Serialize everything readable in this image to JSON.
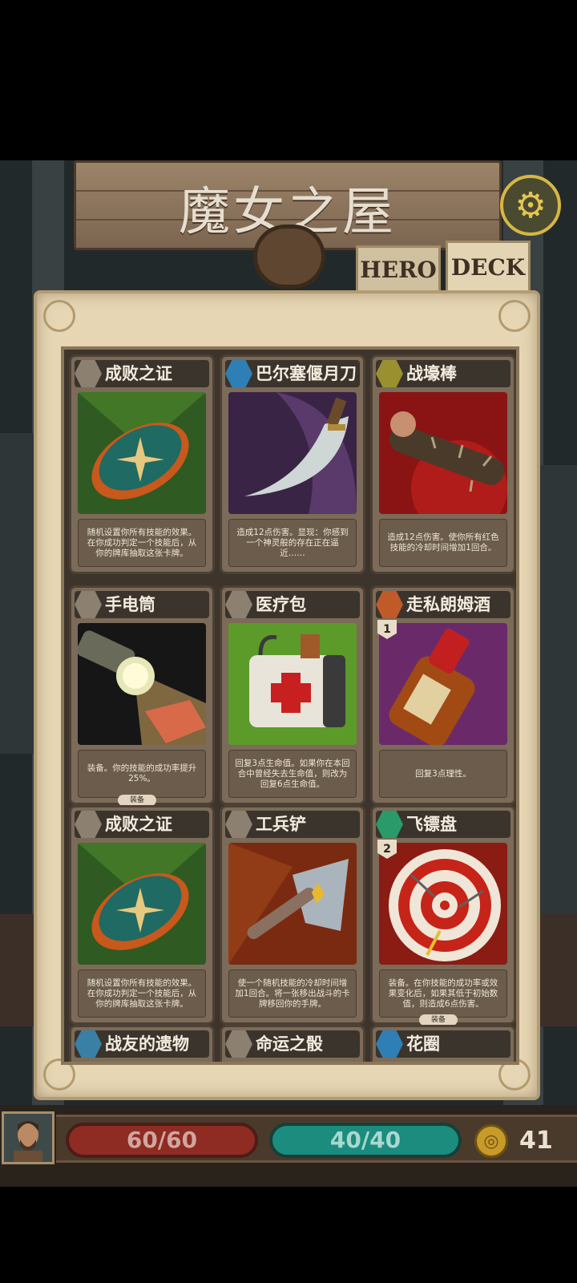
{
  "title": "魔女之屋",
  "tabs": {
    "hero": "HERO",
    "deck": "DECK"
  },
  "settings_icon": "gear-icon",
  "cards": [
    {
      "name": "成败之证",
      "gem": "grey",
      "desc": "随机设置你所有技能的效果。在你成功判定一个技能后，从你的牌库抽取这张卡牌。",
      "badge": "",
      "tag": "",
      "art": "compass"
    },
    {
      "name": "巴尔塞偃月刀",
      "gem": "blue",
      "desc": "造成12点伤害。显现：你感到一个神灵般的存在正在逼近……",
      "badge": "",
      "tag": "",
      "art": "scimitar"
    },
    {
      "name": "战壕棒",
      "gem": "yellow",
      "desc": "造成12点伤害。使你所有红色技能的冷却时间增加1回合。",
      "badge": "",
      "tag": "",
      "art": "club"
    },
    {
      "name": "手电筒",
      "gem": "grey",
      "desc": "装备。你的技能的成功率提升25%。",
      "badge": "",
      "tag": "装备",
      "art": "flashlight"
    },
    {
      "name": "医疗包",
      "gem": "grey",
      "desc": "回复3点生命值。如果你在本回合中曾经失去生命值，则改为回复6点生命值。",
      "badge": "",
      "tag": "",
      "art": "medkit"
    },
    {
      "name": "走私朗姆酒",
      "gem": "orange",
      "desc": "回复3点理性。",
      "badge": "1",
      "tag": "",
      "art": "rum"
    },
    {
      "name": "成败之证",
      "gem": "grey",
      "desc": "随机设置你所有技能的效果。在你成功判定一个技能后，从你的牌库抽取这张卡牌。",
      "badge": "",
      "tag": "",
      "art": "compass"
    },
    {
      "name": "工兵铲",
      "gem": "grey",
      "desc": "使一个随机技能的冷却时间增加1回合。将一张移出战斗的卡牌移回你的手牌。",
      "badge": "",
      "tag": "",
      "art": "shovel"
    },
    {
      "name": "飞镖盘",
      "gem": "green",
      "desc": "装备。在你技能的成功率或效果变化后，如果其低于初始数值，则造成6点伤害。",
      "badge": "2",
      "tag": "装备",
      "art": "dartboard"
    },
    {
      "name": "战友的遗物",
      "gem": "teal",
      "desc": "",
      "badge": "",
      "tag": "",
      "art": ""
    },
    {
      "name": "命运之骰",
      "gem": "grey",
      "desc": "",
      "badge": "",
      "tag": "",
      "art": ""
    },
    {
      "name": "花圈",
      "gem": "blue",
      "desc": "",
      "badge": "",
      "tag": "",
      "art": ""
    }
  ],
  "hud": {
    "hp": "60/60",
    "sanity": "40/40",
    "coins": "41",
    "coin_icon": "coin-icon",
    "avatar": "hero-portrait"
  },
  "colors": {
    "hp": "#8e2b22",
    "sanity": "#1b8c7e",
    "parchment": "#e6d6b4",
    "accent_gold": "#d7b743"
  }
}
